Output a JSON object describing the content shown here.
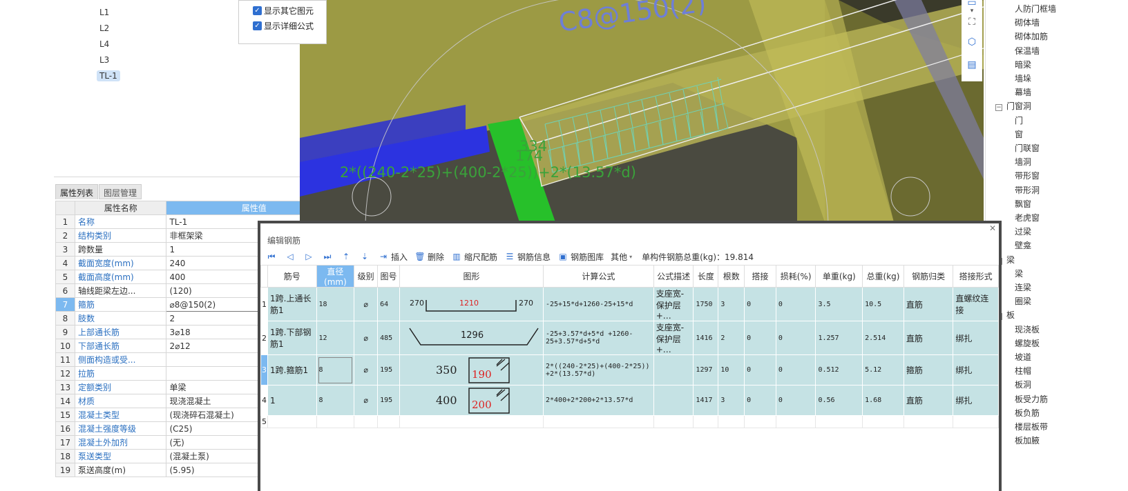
{
  "tree": {
    "items": [
      "L1",
      "L2",
      "L4",
      "L3",
      "TL-1"
    ],
    "selected": "TL-1"
  },
  "options": {
    "show_other": "显示其它图元",
    "show_formula": "显示详细公式"
  },
  "viewport": {
    "spec_text": "C8@150(2)",
    "dim_1": "334",
    "dim_2": "174",
    "formula_text": "2*((240-2*25)+(400-2*25))+2*(13.57*d)"
  },
  "prop_panel": {
    "tabs": [
      "属性列表",
      "图层管理"
    ],
    "active_tab": "属性列表",
    "header_name": "属性名称",
    "header_value": "属性值",
    "rows": [
      {
        "idx": "1",
        "name": "名称",
        "value": "TL-1"
      },
      {
        "idx": "2",
        "name": "结构类别",
        "value": "非框架梁"
      },
      {
        "idx": "3",
        "name": "跨数量",
        "value": "1"
      },
      {
        "idx": "4",
        "name": "截面宽度(mm)",
        "value": "240"
      },
      {
        "idx": "5",
        "name": "截面高度(mm)",
        "value": "400"
      },
      {
        "idx": "6",
        "name": "轴线距梁左边...",
        "value": "(120)"
      },
      {
        "idx": "7",
        "name": "箍筋",
        "value": "⌀8@150(2)"
      },
      {
        "idx": "8",
        "name": "肢数",
        "value": "2"
      },
      {
        "idx": "9",
        "name": "上部通长筋",
        "value": "3⌀18"
      },
      {
        "idx": "10",
        "name": "下部通长筋",
        "value": "2⌀12"
      },
      {
        "idx": "11",
        "name": "侧面构造或受...",
        "value": ""
      },
      {
        "idx": "12",
        "name": "拉筋",
        "value": ""
      },
      {
        "idx": "13",
        "name": "定额类别",
        "value": "单梁"
      },
      {
        "idx": "14",
        "name": "材质",
        "value": "现浇混凝土"
      },
      {
        "idx": "15",
        "name": "混凝土类型",
        "value": "(现浇碎石混凝土)"
      },
      {
        "idx": "16",
        "name": "混凝土强度等级",
        "value": "(C25)"
      },
      {
        "idx": "17",
        "name": "混凝土外加剂",
        "value": "(无)"
      },
      {
        "idx": "18",
        "name": "泵送类型",
        "value": "(混凝土泵)"
      },
      {
        "idx": "19",
        "name": "泵送高度(m)",
        "value": "(5.95)"
      }
    ]
  },
  "comp_tree": {
    "items": [
      {
        "label": "人防门框墙",
        "level": 2
      },
      {
        "label": "砌体墙",
        "level": 2
      },
      {
        "label": "砌体加筋",
        "level": 2
      },
      {
        "label": "保温墙",
        "level": 2
      },
      {
        "label": "暗梁",
        "level": 2
      },
      {
        "label": "墙垛",
        "level": 2
      },
      {
        "label": "幕墙",
        "level": 2
      },
      {
        "label": "门窗洞",
        "level": 1
      },
      {
        "label": "门",
        "level": 2
      },
      {
        "label": "窗",
        "level": 2
      },
      {
        "label": "门联窗",
        "level": 2
      },
      {
        "label": "墙洞",
        "level": 2
      },
      {
        "label": "带形窗",
        "level": 2
      },
      {
        "label": "带形洞",
        "level": 2
      },
      {
        "label": "飘窗",
        "level": 2
      },
      {
        "label": "老虎窗",
        "level": 2
      },
      {
        "label": "过梁",
        "level": 2
      },
      {
        "label": "壁龛",
        "level": 2
      },
      {
        "label": "梁",
        "level": 1
      },
      {
        "label": "梁",
        "level": 2
      },
      {
        "label": "连梁",
        "level": 2
      },
      {
        "label": "圈梁",
        "level": 2
      },
      {
        "label": "板",
        "level": 1
      },
      {
        "label": "现浇板",
        "level": 2
      },
      {
        "label": "螺旋板",
        "level": 2
      },
      {
        "label": "坡道",
        "level": 2
      },
      {
        "label": "柱帽",
        "level": 2
      },
      {
        "label": "板洞",
        "level": 2
      },
      {
        "label": "板受力筋",
        "level": 2
      },
      {
        "label": "板负筋",
        "level": 2
      },
      {
        "label": "楼层板带",
        "level": 2
      },
      {
        "label": "板加腋",
        "level": 2
      }
    ]
  },
  "rebar_dialog": {
    "title": "编辑钢筋",
    "toolbar": {
      "insert": "插入",
      "delete": "删除",
      "scale": "缩尺配筋",
      "info": "钢筋信息",
      "library": "钢筋图库",
      "other": "其他",
      "weight": "单构件钢筋总重(kg)：19.814"
    },
    "headers": [
      "筋号",
      "直径(mm)",
      "级别",
      "图号",
      "图形",
      "计算公式",
      "公式描述",
      "长度",
      "根数",
      "搭接",
      "损耗(%)",
      "单重(kg)",
      "总重(kg)",
      "钢筋归类",
      "搭接形式"
    ],
    "rows": [
      {
        "idx": "1",
        "name": "1跨.上通长筋1",
        "dia": "18",
        "grade": "⌀",
        "fig": "64",
        "shape": {
          "type": "u",
          "left": "270",
          "mid": "1210",
          "right": "270"
        },
        "formula": "-25+15*d+1260-25+15*d",
        "desc": "支座宽-保护层+…",
        "length": "1750",
        "count": "3",
        "lap": "0",
        "loss": "0",
        "unit_w": "3.5",
        "total_w": "10.5",
        "category": "直筋",
        "lap_type": "直螺纹连接"
      },
      {
        "idx": "2",
        "name": "1跨.下部钢筋1",
        "dia": "12",
        "grade": "⌀",
        "fig": "485",
        "shape": {
          "type": "trap",
          "mid": "1296"
        },
        "formula": "-25+3.57*d+5*d +1260-25+3.57*d+5*d",
        "desc": "支座宽-保护层+…",
        "length": "1416",
        "count": "2",
        "lap": "0",
        "loss": "0",
        "unit_w": "1.257",
        "total_w": "2.514",
        "category": "直筋",
        "lap_type": "绑扎"
      },
      {
        "idx": "3",
        "name": "1跨.箍筋1",
        "dia": "8",
        "grade": "⌀",
        "fig": "195",
        "shape": {
          "type": "hoop",
          "a": "350",
          "b": "190"
        },
        "formula": "2*((240-2*25)+(400-2*25)) +2*(13.57*d)",
        "desc": "",
        "length": "1297",
        "count": "10",
        "lap": "0",
        "loss": "0",
        "unit_w": "0.512",
        "total_w": "5.12",
        "category": "箍筋",
        "lap_type": "绑扎"
      },
      {
        "idx": "4",
        "name": "1",
        "dia": "8",
        "grade": "⌀",
        "fig": "195",
        "shape": {
          "type": "hoop",
          "a": "400",
          "b": "200"
        },
        "formula": "2*400+2*200+2*13.57*d",
        "desc": "",
        "length": "1417",
        "count": "3",
        "lap": "0",
        "loss": "0",
        "unit_w": "0.56",
        "total_w": "1.68",
        "category": "直筋",
        "lap_type": "绑扎"
      }
    ],
    "empty_row_idx": "5"
  }
}
